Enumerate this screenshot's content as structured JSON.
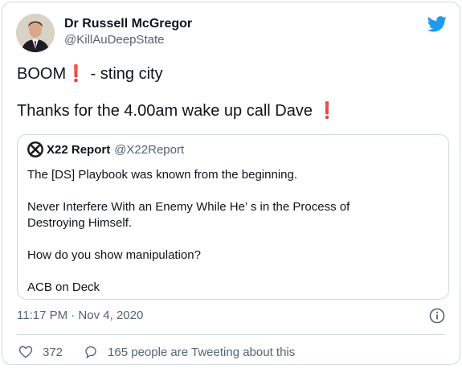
{
  "tweet": {
    "author_name": "Dr Russell McGregor",
    "author_handle": "@KillAuDeepState",
    "lines": [
      {
        "text": "BOOM",
        "excl": "❗",
        "after": " - sting city"
      },
      {
        "text": "Thanks for the 4.00am wake up call Dave ",
        "excl": "❗",
        "after": ""
      }
    ],
    "timestamp": "11:17 PM · Nov 4, 2020",
    "likes": "372",
    "tweeting_about": "165 people are Tweeting about this"
  },
  "quote": {
    "author_name": "X22 Report",
    "author_handle": "@X22Report",
    "lines": [
      "The [DS] Playbook was known from the beginning.",
      "Never Interfere With an Enemy While He’ s in the Process of",
      "Destroying Himself.",
      "How do you show manipulation?",
      "ACB on Deck"
    ]
  },
  "colors": {
    "twitter_blue": "#1d9bf0",
    "exclamation_red": "#e0245e",
    "secondary_text": "#536471",
    "border": "#cfd9de"
  },
  "icons": [
    "twitter-bird-icon",
    "info-icon",
    "heart-icon",
    "reply-bubble-icon"
  ]
}
